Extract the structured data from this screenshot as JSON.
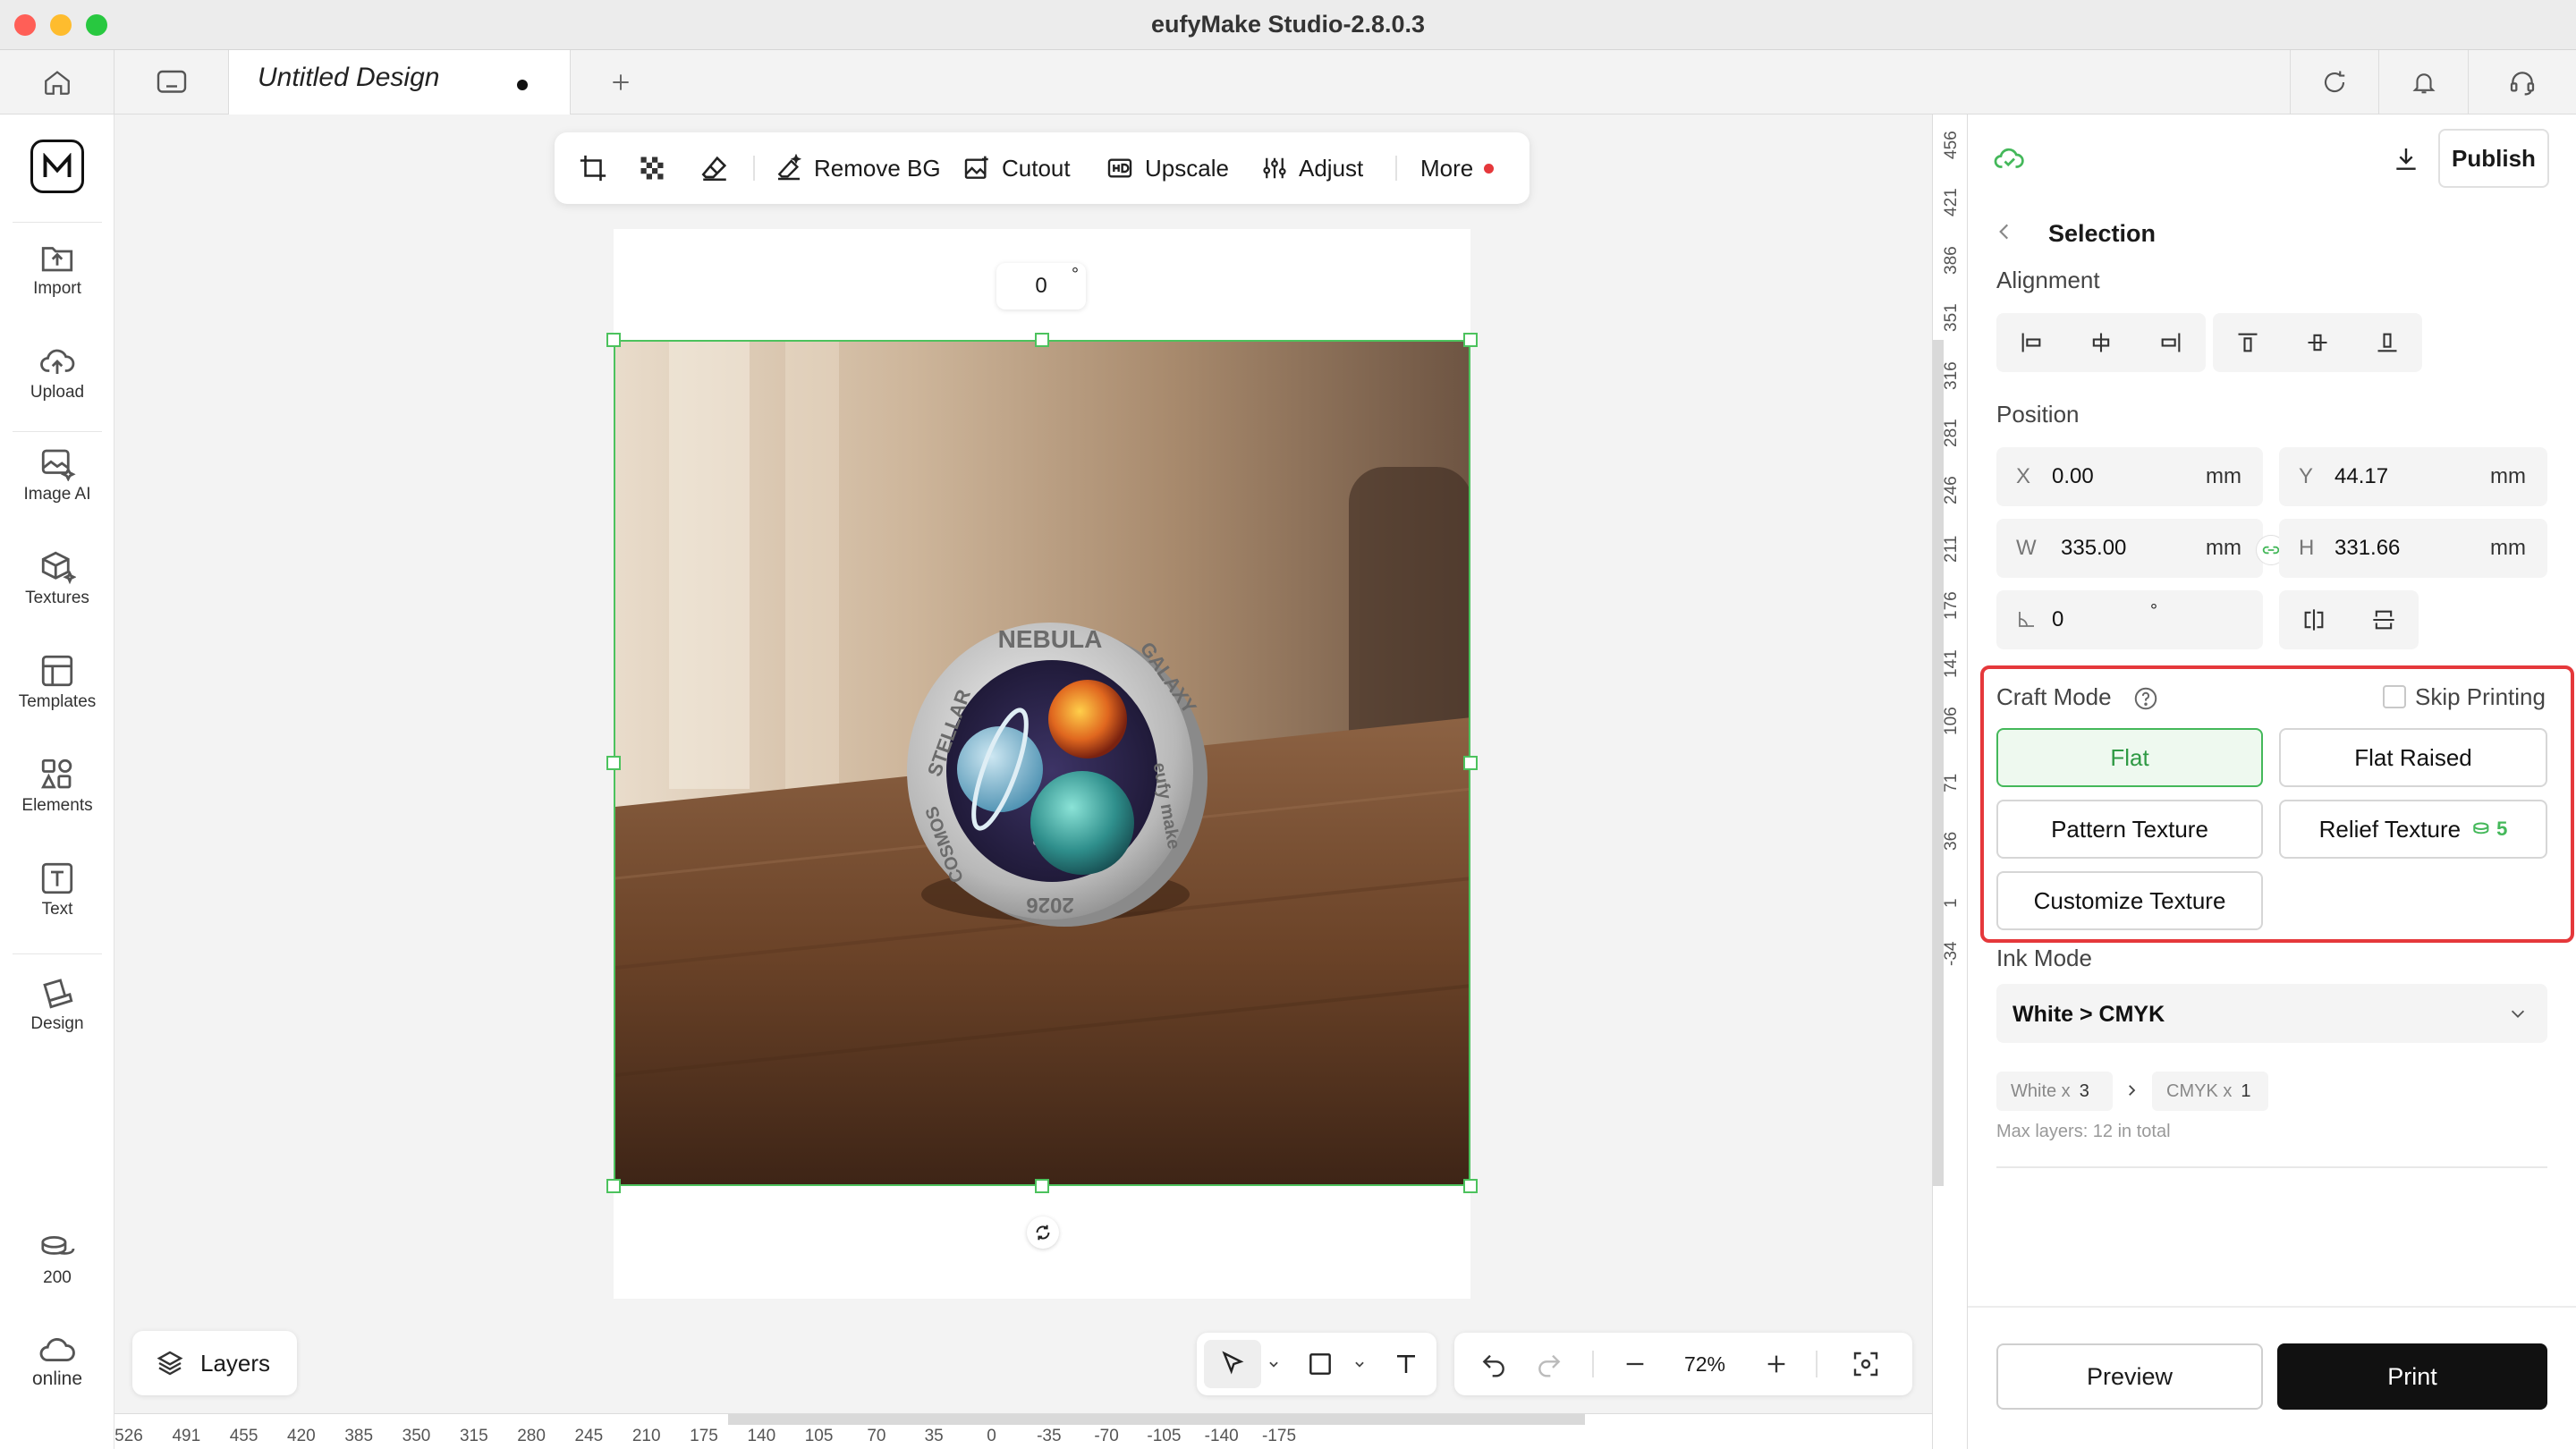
{
  "window": {
    "title": "eufyMake Studio-2.8.0.3"
  },
  "tabs": {
    "active_title": "Untitled Design"
  },
  "sidebar": {
    "items": [
      {
        "label": "Import",
        "icon": "import-icon"
      },
      {
        "label": "Upload",
        "icon": "cloud-upload-icon"
      },
      {
        "label": "Image AI",
        "icon": "image-ai-icon"
      },
      {
        "label": "Textures",
        "icon": "textures-icon"
      },
      {
        "label": "Templates",
        "icon": "templates-icon"
      },
      {
        "label": "Elements",
        "icon": "elements-icon"
      },
      {
        "label": "Text",
        "icon": "text-icon"
      },
      {
        "label": "Design",
        "icon": "design-icon"
      }
    ],
    "credits": "200",
    "status": "online"
  },
  "toolbar": {
    "remove_bg": "Remove BG",
    "cutout": "Cutout",
    "upscale": "Upscale",
    "adjust": "Adjust",
    "more": "More"
  },
  "canvas": {
    "rotation_value": "0",
    "rotation_unit": "°",
    "coin_text": {
      "top": "NEBULA",
      "left": "STELLAR",
      "right": "GALAXY",
      "right_lower": "eufy make",
      "bottom_left": "COSMOS",
      "bottom": "2026"
    }
  },
  "bottom_bar": {
    "layers_label": "Layers",
    "zoom": "72%"
  },
  "ruler_h": [
    "526",
    "491",
    "455",
    "420",
    "385",
    "350",
    "315",
    "280",
    "245",
    "210",
    "175",
    "140",
    "105",
    "70",
    "35",
    "0",
    "-35",
    "-70",
    "-105",
    "-140",
    "-175"
  ],
  "ruler_v": [
    "456",
    "421",
    "386",
    "351",
    "316",
    "281",
    "246",
    "211",
    "176",
    "141",
    "106",
    "71",
    "36",
    "1",
    "-34"
  ],
  "panel": {
    "publish_label": "Publish",
    "selection_title": "Selection",
    "alignment_label": "Alignment",
    "position_label": "Position",
    "x": {
      "label": "X",
      "value": "0.00",
      "unit": "mm"
    },
    "y": {
      "label": "Y",
      "value": "44.17",
      "unit": "mm"
    },
    "w": {
      "label": "W",
      "value": "335.00",
      "unit": "mm"
    },
    "h": {
      "label": "H",
      "value": "331.66",
      "unit": "mm"
    },
    "angle": {
      "value": "0",
      "unit": "°"
    },
    "craft_mode_label": "Craft Mode",
    "skip_printing_label": "Skip Printing",
    "modes": {
      "flat": "Flat",
      "flat_raised": "Flat Raised",
      "pattern_texture": "Pattern Texture",
      "relief_texture": "Relief Texture",
      "relief_cost": "5",
      "customize_texture": "Customize Texture"
    },
    "ink_mode_label": "Ink Mode",
    "ink_mode_value": "White > CMYK",
    "white_chip": {
      "label": "White x",
      "value": "3"
    },
    "cmyk_chip": {
      "label": "CMYK x",
      "value": "1"
    },
    "max_layers": "Max layers: 12 in total",
    "preview_label": "Preview",
    "print_label": "Print"
  },
  "colors": {
    "accent_green": "#44b85a",
    "highlight_red": "#e5383b",
    "print_button": "#111111"
  }
}
